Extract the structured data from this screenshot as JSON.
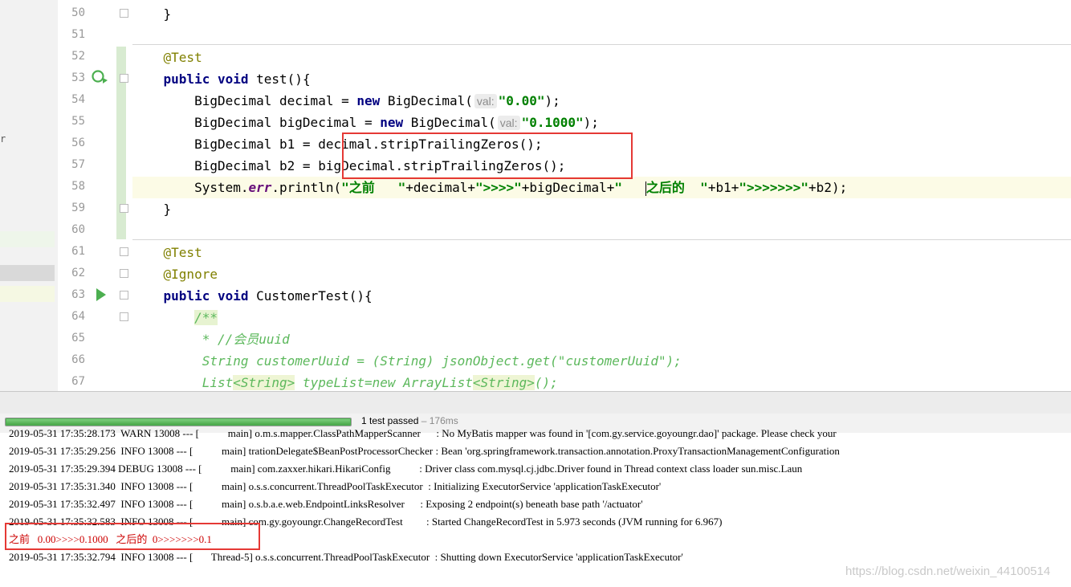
{
  "editor": {
    "line_numbers": [
      "50",
      "51",
      "52",
      "53",
      "54",
      "55",
      "56",
      "57",
      "58",
      "59",
      "60",
      "61",
      "62",
      "63",
      "64",
      "65",
      "66",
      "67"
    ],
    "lines": {
      "l50": "}",
      "l52": "@Test",
      "l53": {
        "kw1": "public",
        "kw2": "void",
        "rest": "test(){"
      },
      "l54": {
        "a": "BigDecimal decimal = ",
        "kw": "new",
        "b": "BigDecimal(",
        "hint": "val:",
        "str": "\"0.00\"",
        "c": ");"
      },
      "l55": {
        "a": "BigDecimal bigDecimal = ",
        "kw": "new",
        "b": "BigDecimal(",
        "hint": "val:",
        "str": "\"0.1000\"",
        "c": ");"
      },
      "l56": {
        "a": "BigDecimal b1 = ",
        "b": "decimal.stripTrailingZeros();"
      },
      "l57": {
        "a": "BigDecimal b2 = ",
        "b": "bigDecimal.stripTrailingZeros();"
      },
      "l58": {
        "a": "System.",
        "field": "err",
        "b": ".println(",
        "s1": "\"之前   \"",
        "c": "+decimal+",
        "s2": "\">>>>\"",
        "d": "+bigDecimal+",
        "s3": "\"   ",
        "s4": "之后的  \"",
        "e": "+b1+",
        "s5": "\">>>>>>>\"",
        "f": "+b2);"
      },
      "l59": "}",
      "l61": "@Test",
      "l62": "@Ignore",
      "l63": {
        "kw1": "public",
        "kw2": "void",
        "rest": "CustomerTest(){"
      },
      "l64": "/**",
      "l65": " * //会员uuid",
      "l66": " String customerUuid = (String) jsonObject.get(\"customerUuid\");",
      "l67": {
        "a": " List",
        "g1": "<String>",
        "b": " typeList=new ArrayList",
        "g2": "<String>",
        "c": "();"
      }
    }
  },
  "run": {
    "progress": 1.0,
    "status": "1 test passed",
    "duration": "– 176ms"
  },
  "console": {
    "lines": [
      "2019-05-31 17:35:28.173  WARN 13008 --- [           main] o.m.s.mapper.ClassPathMapperScanner      : No MyBatis mapper was found in '[com.gy.service.goyoungr.dao]' package. Please check your",
      "2019-05-31 17:35:29.256  INFO 13008 --- [           main] trationDelegate$BeanPostProcessorChecker : Bean 'org.springframework.transaction.annotation.ProxyTransactionManagementConfiguration",
      "2019-05-31 17:35:29.394 DEBUG 13008 --- [           main] com.zaxxer.hikari.HikariConfig           : Driver class com.mysql.cj.jdbc.Driver found in Thread context class loader sun.misc.Laun",
      "2019-05-31 17:35:31.340  INFO 13008 --- [           main] o.s.s.concurrent.ThreadPoolTaskExecutor  : Initializing ExecutorService 'applicationTaskExecutor'",
      "2019-05-31 17:35:32.497  INFO 13008 --- [           main] o.s.b.a.e.web.EndpointLinksResolver      : Exposing 2 endpoint(s) beneath base path '/actuator'",
      "2019-05-31 17:35:32.583  INFO 13008 --- [           main] com.gy.goyoungr.ChangeRecordTest         : Started ChangeRecordTest in 5.973 seconds (JVM running for 6.967)",
      "之前   0.00>>>>0.1000   之后的  0>>>>>>>0.1",
      "2019-05-31 17:35:32.794  INFO 13008 --- [       Thread-5] o.s.s.concurrent.ThreadPoolTaskExecutor  : Shutting down ExecutorService 'applicationTaskExecutor'"
    ]
  },
  "watermark": "https://blog.csdn.net/weixin_44100514",
  "colors": {
    "keyword": "#000080",
    "string": "#008000",
    "annotation": "#808000",
    "highlight_box": "#e53935",
    "progress": "#4caf50"
  }
}
